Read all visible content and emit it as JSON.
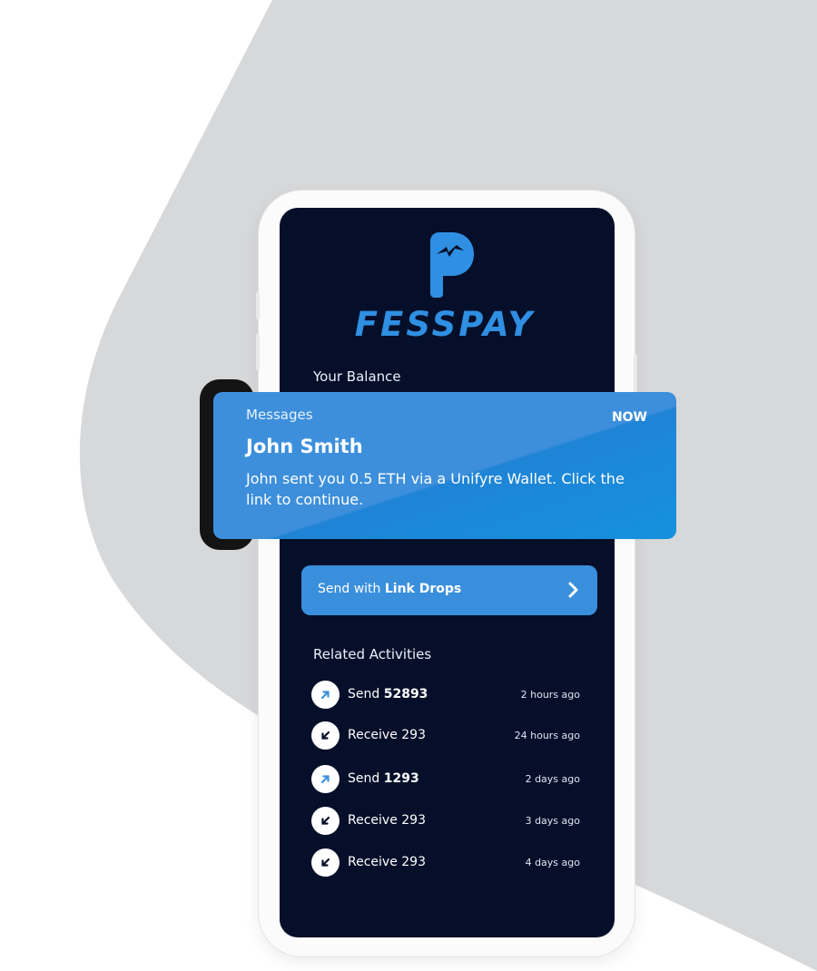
{
  "app": {
    "brand_name": "FESSPAY",
    "logo_icon": "fesspay-p-logo-icon",
    "brand_color": "#2f8fe2",
    "screen_bg": "#050f29"
  },
  "balance": {
    "label": "Your Balance"
  },
  "notification": {
    "app_name": "Messages",
    "time": "NOW",
    "title": "John Smith",
    "body": "John sent you 0.5 ETH via a Unifyre Wallet. Click the link to continue.",
    "color": "#3d8fdc"
  },
  "send_button": {
    "prefix": "Send with",
    "emphasis": "Link Drops",
    "icon": "chevron-right-icon"
  },
  "activities": {
    "title": "Related Activities",
    "items": [
      {
        "type": "send",
        "verb": "Send",
        "amount": "52893",
        "time": "2 hours ago",
        "icon": "arrow-up-right-icon"
      },
      {
        "type": "receive",
        "verb": "Receive 293",
        "amount": "",
        "time": "24 hours ago",
        "icon": "arrow-down-left-icon"
      },
      {
        "type": "send",
        "verb": "Send",
        "amount": "1293",
        "time": "2 days ago",
        "icon": "arrow-up-right-icon"
      },
      {
        "type": "receive",
        "verb": "Receive 293",
        "amount": "",
        "time": "3 days ago",
        "icon": "arrow-down-left-icon"
      },
      {
        "type": "receive",
        "verb": "Receive 293",
        "amount": "",
        "time": "4 days ago",
        "icon": "arrow-down-left-icon"
      }
    ]
  }
}
